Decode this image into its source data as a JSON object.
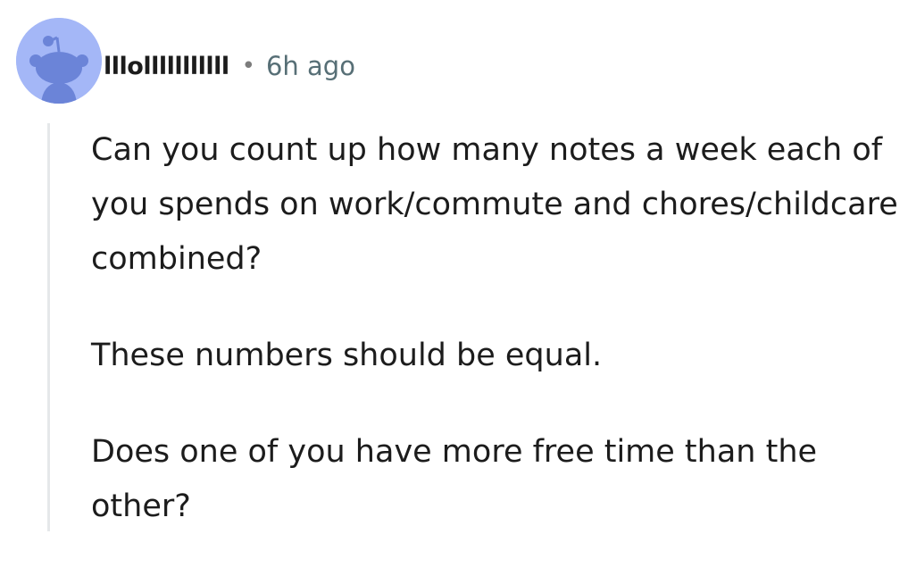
{
  "comment": {
    "author": "lllolllllllllll",
    "separator": "•",
    "timestamp": "6h ago",
    "avatar_icon": "snoo-avatar-icon",
    "avatar_color": "#a4b7f7",
    "paragraphs": [
      "Can you count up how many notes a week each of you spends on work/commute and chores/childcare combined?",
      "These numbers should be equal.",
      "Does one of you have more free time than the other?"
    ]
  }
}
